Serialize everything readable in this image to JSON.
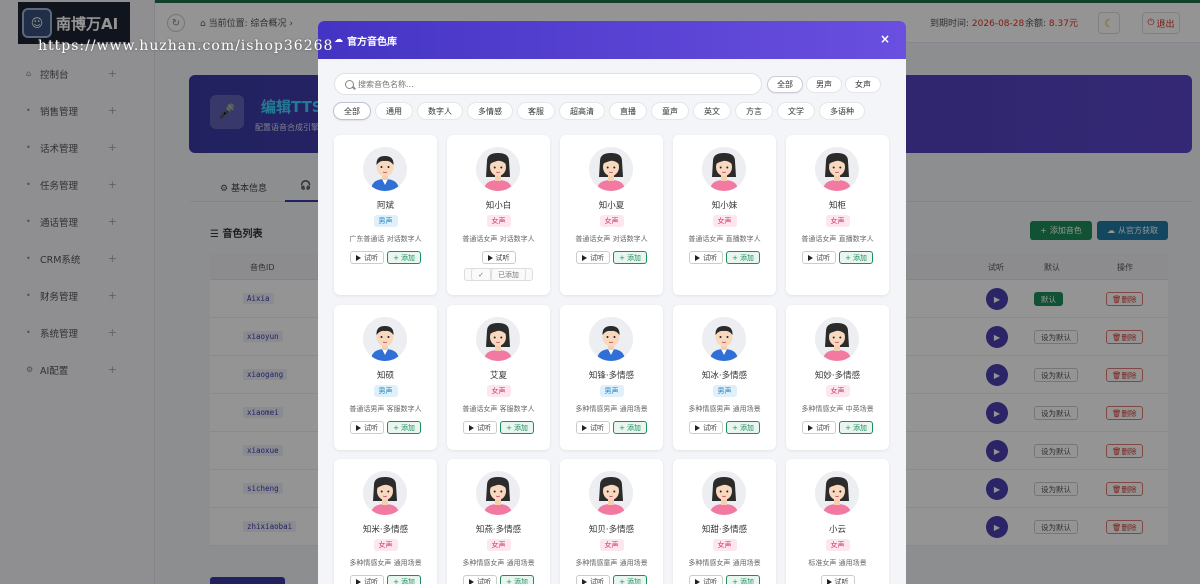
{
  "app": {
    "logo_text": "南博万AI",
    "watermark": "https://www.huzhan.com/ishop36268",
    "nav": [
      {
        "label": "控制台"
      },
      {
        "label": "销售管理"
      },
      {
        "label": "话术管理"
      },
      {
        "label": "任务管理"
      },
      {
        "label": "通话管理"
      },
      {
        "label": "CRM系统"
      },
      {
        "label": "财务管理"
      },
      {
        "label": "系统管理"
      },
      {
        "label": "AI配置"
      }
    ],
    "header": {
      "breadcrumb": "当前位置: 综合概况 ›",
      "expire_label": "到期时间:",
      "expire_value": "2026-08-28",
      "balance_label": "余额:",
      "balance_value": "8.37元",
      "logout": "退出"
    },
    "banner": {
      "title": "编辑TTS",
      "subtitle": "配置语音合成引擎"
    },
    "tabs": [
      {
        "label": "基本信息"
      },
      {
        "label": ""
      }
    ],
    "panel": {
      "title": "音色列表",
      "add_voice": "添加音色",
      "fetch_official": "从官方获取",
      "columns": {
        "voice_id": "音色ID",
        "listen": "试听",
        "default": "默认",
        "op": "操作"
      },
      "rows": [
        {
          "id": "Aixia",
          "default": "默认"
        },
        {
          "id": "xiaoyun",
          "default": "设为默认"
        },
        {
          "id": "xiaogang",
          "default": "设为默认"
        },
        {
          "id": "xiaomei",
          "default": "设为默认"
        },
        {
          "id": "xiaoxue",
          "default": "设为默认"
        },
        {
          "id": "sicheng",
          "default": "设为默认"
        },
        {
          "id": "zhixiaobai",
          "default": "设为默认"
        }
      ],
      "delete_label": "删除"
    }
  },
  "modal": {
    "title": "官方音色库",
    "close": "×",
    "search": {
      "placeholder": "搜索音色名称..."
    },
    "gender_filters": [
      {
        "label": "全部",
        "active": true
      },
      {
        "label": "男声"
      },
      {
        "label": "女声"
      }
    ],
    "categories": [
      {
        "label": "全部",
        "active": true
      },
      {
        "label": "通用"
      },
      {
        "label": "数字人"
      },
      {
        "label": "多情感"
      },
      {
        "label": "客服"
      },
      {
        "label": "超高清"
      },
      {
        "label": "直播"
      },
      {
        "label": "童声"
      },
      {
        "label": "英文"
      },
      {
        "label": "方言"
      },
      {
        "label": "文学"
      },
      {
        "label": "多语种"
      }
    ],
    "try_label": "试听",
    "add_label": "添加",
    "added_label": "已添加",
    "voices": [
      {
        "name": "阿斌",
        "gender": "男声",
        "desc": "广东普通话 对话数字人",
        "g": "m"
      },
      {
        "name": "知小白",
        "gender": "女声",
        "desc": "普通话女声 对话数字人",
        "g": "f",
        "added": true
      },
      {
        "name": "知小夏",
        "gender": "女声",
        "desc": "普通话女声 对话数字人",
        "g": "f"
      },
      {
        "name": "知小妹",
        "gender": "女声",
        "desc": "普通话女声 直播数字人",
        "g": "f"
      },
      {
        "name": "知柜",
        "gender": "女声",
        "desc": "普通话女声 直播数字人",
        "g": "f"
      },
      {
        "name": "知硕",
        "gender": "男声",
        "desc": "普通话男声 客服数字人",
        "g": "m"
      },
      {
        "name": "艾夏",
        "gender": "女声",
        "desc": "普通话女声 客服数字人",
        "g": "f"
      },
      {
        "name": "知锋·多情感",
        "gender": "男声",
        "desc": "多种情感男声 通用场景",
        "g": "m"
      },
      {
        "name": "知冰·多情感",
        "gender": "男声",
        "desc": "多种情感男声 通用场景",
        "g": "m"
      },
      {
        "name": "知妙·多情感",
        "gender": "女声",
        "desc": "多种情感女声 中英场景",
        "g": "f"
      },
      {
        "name": "知米·多情感",
        "gender": "女声",
        "desc": "多种情感女声 通用场景",
        "g": "f"
      },
      {
        "name": "知燕·多情感",
        "gender": "女声",
        "desc": "多种情感女声 通用场景",
        "g": "f"
      },
      {
        "name": "知贝·多情感",
        "gender": "女声",
        "desc": "多种情感童声 通用场景",
        "g": "f"
      },
      {
        "name": "知甜·多情感",
        "gender": "女声",
        "desc": "多种情感女声 通用场景",
        "g": "f"
      },
      {
        "name": "小云",
        "gender": "女声",
        "desc": "标准女声 通用场景",
        "g": "f",
        "try_only": true
      }
    ]
  }
}
